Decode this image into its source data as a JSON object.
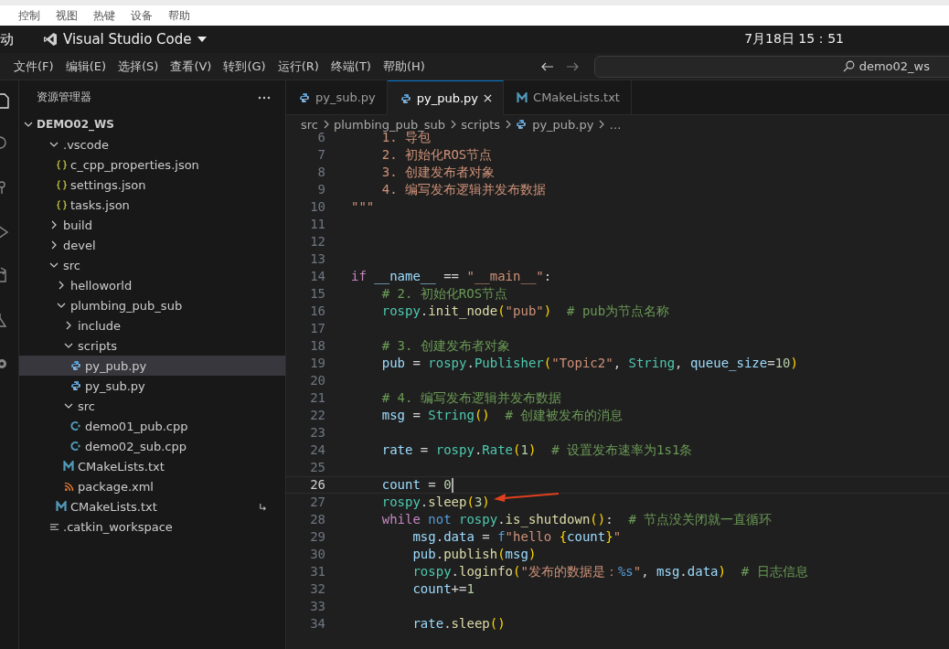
{
  "vm_menu": [
    "控制",
    "视图",
    "热键",
    "设备",
    "帮助"
  ],
  "top_bar": {
    "activities": "动",
    "app_name": "Visual Studio Code",
    "clock": "7月18日  15：51"
  },
  "menu_bar": {
    "items": [
      "文件(F)",
      "编辑(E)",
      "选择(S)",
      "查看(V)",
      "转到(G)",
      "运行(R)",
      "终端(T)",
      "帮助(H)"
    ],
    "search": "demo02_ws"
  },
  "explorer": {
    "title": "资源管理器",
    "root": {
      "name": "DEMO02_WS",
      "expanded": true
    },
    "tree": [
      {
        "name": ".vscode",
        "kind": "folder",
        "expanded": true,
        "selected": false,
        "children": [
          {
            "name": "c_cpp_properties.json",
            "kind": "json",
            "selected": false
          },
          {
            "name": "settings.json",
            "kind": "json",
            "selected": false
          },
          {
            "name": "tasks.json",
            "kind": "json",
            "selected": false
          }
        ]
      },
      {
        "name": "build",
        "kind": "folder",
        "expanded": false,
        "selected": false
      },
      {
        "name": "devel",
        "kind": "folder",
        "expanded": false,
        "selected": false
      },
      {
        "name": "src",
        "kind": "folder",
        "expanded": true,
        "selected": false,
        "children": [
          {
            "name": "helloworld",
            "kind": "folder",
            "expanded": false,
            "selected": false
          },
          {
            "name": "plumbing_pub_sub",
            "kind": "folder",
            "expanded": true,
            "selected": false,
            "children": [
              {
                "name": "include",
                "kind": "folder",
                "expanded": false,
                "selected": false
              },
              {
                "name": "scripts",
                "kind": "folder",
                "expanded": true,
                "selected": false,
                "children": [
                  {
                    "name": "py_pub.py",
                    "kind": "python",
                    "selected": true
                  },
                  {
                    "name": "py_sub.py",
                    "kind": "python",
                    "selected": false
                  }
                ]
              },
              {
                "name": "src",
                "kind": "folder",
                "expanded": true,
                "selected": false,
                "children": [
                  {
                    "name": "demo01_pub.cpp",
                    "kind": "cpp",
                    "selected": false
                  },
                  {
                    "name": "demo02_sub.cpp",
                    "kind": "cpp",
                    "selected": false
                  }
                ]
              },
              {
                "name": "CMakeLists.txt",
                "kind": "cmake",
                "selected": false
              },
              {
                "name": "package.xml",
                "kind": "xml",
                "selected": false
              }
            ]
          },
          {
            "name": "CMakeLists.txt",
            "kind": "cmake",
            "selected": false,
            "linked": true
          }
        ]
      },
      {
        "name": ".catkin_workspace",
        "kind": "text",
        "selected": false
      }
    ]
  },
  "tabs": [
    {
      "label": "py_sub.py",
      "kind": "python",
      "selected": false
    },
    {
      "label": "py_pub.py",
      "kind": "python",
      "selected": true
    },
    {
      "label": "CMakeLists.txt",
      "kind": "cmake",
      "selected": false
    }
  ],
  "breadcrumb": [
    {
      "label": "src",
      "kind": "folder"
    },
    {
      "label": "plumbing_pub_sub",
      "kind": "folder"
    },
    {
      "label": "scripts",
      "kind": "folder"
    },
    {
      "label": "py_pub.py",
      "kind": "python"
    },
    {
      "label": "…",
      "kind": "folder"
    }
  ],
  "code": [
    {
      "n": "6",
      "current": false,
      "tokens": [
        {
          "t": "    1. 导包",
          "kind": "str"
        }
      ]
    },
    {
      "n": "7",
      "current": false,
      "tokens": [
        {
          "t": "    2. 初始化ROS节点",
          "kind": "str"
        }
      ]
    },
    {
      "n": "8",
      "current": false,
      "tokens": [
        {
          "t": "    3. 创建发布者对象",
          "kind": "str"
        }
      ]
    },
    {
      "n": "9",
      "current": false,
      "tokens": [
        {
          "t": "    4. 编写发布逻辑并发布数据",
          "kind": "str"
        }
      ]
    },
    {
      "n": "10",
      "current": false,
      "tokens": [
        {
          "t": "\"\"\"",
          "kind": "str"
        }
      ]
    },
    {
      "n": "11",
      "current": false
    },
    {
      "n": "12",
      "current": false
    },
    {
      "n": "13",
      "current": false
    },
    {
      "n": "14",
      "current": false,
      "tokens": [
        {
          "t": "if ",
          "kind": "kw"
        },
        {
          "t": "__name__",
          "kind": "var"
        },
        {
          "t": " == ",
          "kind": "p"
        },
        {
          "t": "\"__main__\"",
          "kind": "str"
        },
        {
          "t": ":",
          "kind": "p"
        }
      ]
    },
    {
      "n": "15",
      "current": false,
      "tokens": [
        {
          "t": "    # 2. 初始化ROS节点",
          "kind": "com"
        }
      ]
    },
    {
      "n": "16",
      "current": false,
      "tokens": [
        {
          "t": "    rospy",
          "kind": "cls"
        },
        {
          "t": ".",
          "kind": "p"
        },
        {
          "t": "init_node",
          "kind": "fn"
        },
        {
          "t": "(",
          "kind": "br"
        },
        {
          "t": "\"pub\"",
          "kind": "str"
        },
        {
          "t": ")",
          "kind": "br"
        },
        {
          "t": "  # pub为节点名称",
          "kind": "com"
        }
      ]
    },
    {
      "n": "17",
      "current": false
    },
    {
      "n": "18",
      "current": false,
      "tokens": [
        {
          "t": "    # 3. 创建发布者对象",
          "kind": "com"
        }
      ]
    },
    {
      "n": "19",
      "current": false,
      "tokens": [
        {
          "t": "    pub",
          "kind": "var"
        },
        {
          "t": " = ",
          "kind": "p"
        },
        {
          "t": "rospy",
          "kind": "cls"
        },
        {
          "t": ".",
          "kind": "p"
        },
        {
          "t": "Publisher",
          "kind": "cls"
        },
        {
          "t": "(",
          "kind": "br"
        },
        {
          "t": "\"Topic2\"",
          "kind": "str"
        },
        {
          "t": ", ",
          "kind": "p"
        },
        {
          "t": "String",
          "kind": "cls"
        },
        {
          "t": ", ",
          "kind": "p"
        },
        {
          "t": "queue_size",
          "kind": "var"
        },
        {
          "t": "=",
          "kind": "p"
        },
        {
          "t": "10",
          "kind": "num"
        },
        {
          "t": ")",
          "kind": "br"
        }
      ]
    },
    {
      "n": "20",
      "current": false
    },
    {
      "n": "21",
      "current": false,
      "tokens": [
        {
          "t": "    # 4. 编写发布逻辑并发布数据",
          "kind": "com"
        }
      ]
    },
    {
      "n": "22",
      "current": false,
      "tokens": [
        {
          "t": "    msg",
          "kind": "var"
        },
        {
          "t": " = ",
          "kind": "p"
        },
        {
          "t": "String",
          "kind": "cls"
        },
        {
          "t": "()",
          "kind": "br"
        },
        {
          "t": "  # 创建被发布的消息",
          "kind": "com"
        }
      ]
    },
    {
      "n": "23",
      "current": false
    },
    {
      "n": "24",
      "current": false,
      "tokens": [
        {
          "t": "    rate",
          "kind": "var"
        },
        {
          "t": " = ",
          "kind": "p"
        },
        {
          "t": "rospy",
          "kind": "cls"
        },
        {
          "t": ".",
          "kind": "p"
        },
        {
          "t": "Rate",
          "kind": "cls"
        },
        {
          "t": "(",
          "kind": "br"
        },
        {
          "t": "1",
          "kind": "num"
        },
        {
          "t": ")",
          "kind": "br"
        },
        {
          "t": "  # 设置发布速率为1s1条",
          "kind": "com"
        }
      ]
    },
    {
      "n": "25",
      "current": false
    },
    {
      "n": "26",
      "current": true,
      "tokens": [
        {
          "t": "    count",
          "kind": "var"
        },
        {
          "t": " = ",
          "kind": "p"
        },
        {
          "t": "0",
          "kind": "num"
        }
      ]
    },
    {
      "n": "27",
      "current": false,
      "tokens": [
        {
          "t": "    rospy",
          "kind": "cls"
        },
        {
          "t": ".",
          "kind": "p"
        },
        {
          "t": "sleep",
          "kind": "fn"
        },
        {
          "t": "(",
          "kind": "br"
        },
        {
          "t": "3",
          "kind": "num"
        },
        {
          "t": ")",
          "kind": "br"
        }
      ]
    },
    {
      "n": "28",
      "current": false,
      "tokens": [
        {
          "t": "    while ",
          "kind": "kw"
        },
        {
          "t": "not ",
          "kind": "kw2"
        },
        {
          "t": "rospy",
          "kind": "cls"
        },
        {
          "t": ".",
          "kind": "p"
        },
        {
          "t": "is_shutdown",
          "kind": "fn"
        },
        {
          "t": "()",
          "kind": "br"
        },
        {
          "t": ":",
          "kind": "p"
        },
        {
          "t": "  # 节点没关闭就一直循环",
          "kind": "com"
        }
      ]
    },
    {
      "n": "29",
      "current": false,
      "tokens": [
        {
          "t": "        msg",
          "kind": "var"
        },
        {
          "t": ".",
          "kind": "p"
        },
        {
          "t": "data",
          "kind": "var"
        },
        {
          "t": " = ",
          "kind": "p"
        },
        {
          "t": "f",
          "kind": "kw2"
        },
        {
          "t": "\"hello ",
          "kind": "str"
        },
        {
          "t": "{",
          "kind": "br"
        },
        {
          "t": "count",
          "kind": "var"
        },
        {
          "t": "}",
          "kind": "br"
        },
        {
          "t": "\"",
          "kind": "str"
        }
      ]
    },
    {
      "n": "30",
      "current": false,
      "tokens": [
        {
          "t": "        pub",
          "kind": "var"
        },
        {
          "t": ".",
          "kind": "p"
        },
        {
          "t": "publish",
          "kind": "fn"
        },
        {
          "t": "(",
          "kind": "br"
        },
        {
          "t": "msg",
          "kind": "var"
        },
        {
          "t": ")",
          "kind": "br"
        }
      ]
    },
    {
      "n": "31",
      "current": false,
      "tokens": [
        {
          "t": "        rospy",
          "kind": "cls"
        },
        {
          "t": ".",
          "kind": "p"
        },
        {
          "t": "loginfo",
          "kind": "fn"
        },
        {
          "t": "(",
          "kind": "br"
        },
        {
          "t": "\"发布的数据是：",
          "kind": "str"
        },
        {
          "t": "%s",
          "kind": "kw2"
        },
        {
          "t": "\"",
          "kind": "str"
        },
        {
          "t": ", ",
          "kind": "p"
        },
        {
          "t": "msg",
          "kind": "var"
        },
        {
          "t": ".",
          "kind": "p"
        },
        {
          "t": "data",
          "kind": "var"
        },
        {
          "t": ")",
          "kind": "br"
        },
        {
          "t": "  # 日志信息",
          "kind": "com"
        }
      ]
    },
    {
      "n": "32",
      "current": false,
      "tokens": [
        {
          "t": "        count",
          "kind": "var"
        },
        {
          "t": "+=",
          "kind": "p"
        },
        {
          "t": "1",
          "kind": "num"
        }
      ]
    },
    {
      "n": "33",
      "current": false
    },
    {
      "n": "34",
      "current": false,
      "tokens": [
        {
          "t": "        rate",
          "kind": "var"
        },
        {
          "t": ".",
          "kind": "p"
        },
        {
          "t": "sleep",
          "kind": "fn"
        },
        {
          "t": "()",
          "kind": "br"
        }
      ]
    }
  ]
}
